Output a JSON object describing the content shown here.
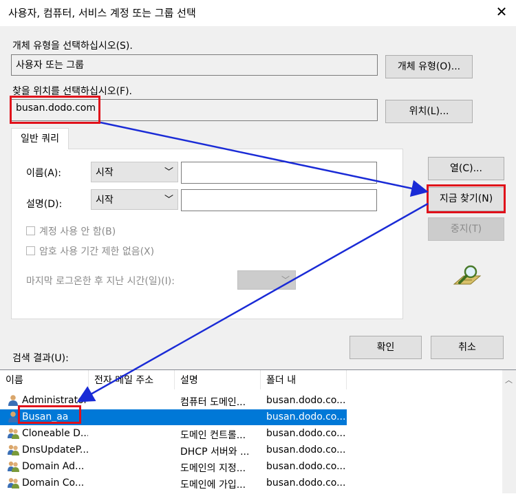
{
  "window": {
    "title": "사용자, 컴퓨터, 서비스 계정 또는 그룹 선택",
    "close": "✕"
  },
  "object_type": {
    "label": "개체 유형을 선택하십시오(S).",
    "value": "사용자 또는 그룹",
    "button": "개체 유형(O)..."
  },
  "location": {
    "label": "찾을 위치를 선택하십시오(F).",
    "value": "busan.dodo.com",
    "button": "위치(L)..."
  },
  "query": {
    "tab": "일반 쿼리",
    "name_label": "이름(A):",
    "name_mode": "시작",
    "desc_label": "설명(D):",
    "desc_mode": "시작",
    "disabled_accounts": "계정 사용 안 함(B)",
    "no_expire_pw": "암호 사용 기간 제한 없음(X)",
    "days_since_login": "마지막 로그온한 후 지난 시간(일)(I):"
  },
  "buttons": {
    "columns": "열(C)...",
    "find_now": "지금 찾기(N)",
    "stop": "중지(T)",
    "ok": "확인",
    "cancel": "취소"
  },
  "results": {
    "label": "검색 결과(U):",
    "headers": [
      "이름",
      "전자 메일 주소",
      "설명",
      "폴더 내"
    ],
    "rows": [
      {
        "name": "Administrator",
        "email": "",
        "desc": "컴퓨터 도메인...",
        "folder": "busan.dodo.co...",
        "icon": "user-icon"
      },
      {
        "name": "Busan_aa",
        "email": "",
        "desc": "",
        "folder": "busan.dodo.co...",
        "icon": "user-icon",
        "selected": true
      },
      {
        "name": "Cloneable D...",
        "email": "",
        "desc": "도메인 컨트롤...",
        "folder": "busan.dodo.co...",
        "icon": "group-icon"
      },
      {
        "name": "DnsUpdateP...",
        "email": "",
        "desc": "DHCP 서버와 ...",
        "folder": "busan.dodo.co...",
        "icon": "group-icon"
      },
      {
        "name": "Domain Ad...",
        "email": "",
        "desc": "도메인의 지정...",
        "folder": "busan.dodo.co...",
        "icon": "group-icon"
      },
      {
        "name": "Domain Co...",
        "email": "",
        "desc": "도메인에 가입...",
        "folder": "busan.dodo.co...",
        "icon": "group-icon"
      }
    ]
  },
  "colors": {
    "highlight": "#e0101a",
    "arrow": "#1a2bd6",
    "selection": "#0078d7"
  }
}
